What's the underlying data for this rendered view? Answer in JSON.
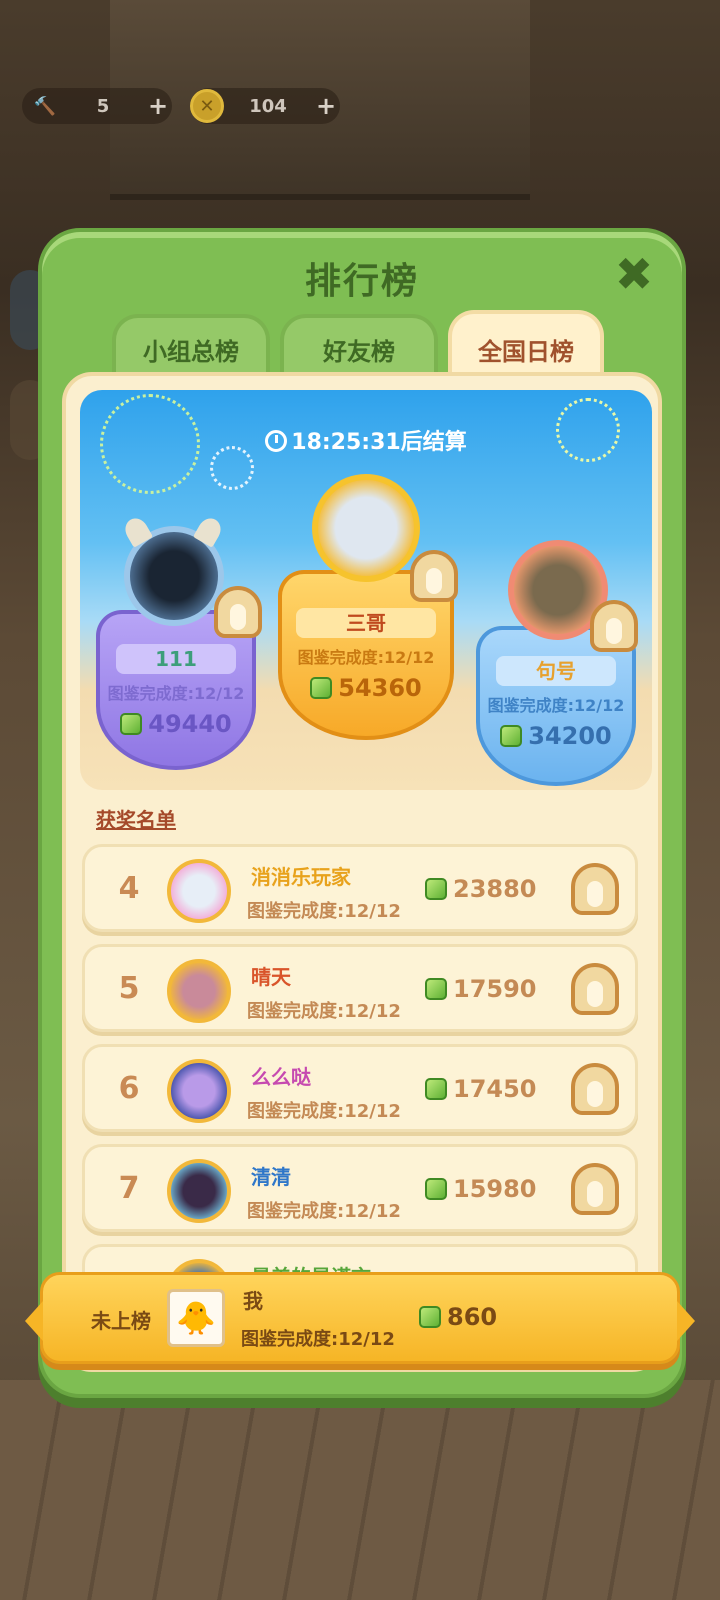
{
  "resources": {
    "hammer": {
      "value": "5",
      "plus": "+"
    },
    "coin": {
      "value": "104",
      "plus": "+"
    }
  },
  "panel": {
    "title": "排行榜",
    "close_icon": "✖"
  },
  "tabs": [
    {
      "label": "小组总榜",
      "active": false
    },
    {
      "label": "好友榜",
      "active": false
    },
    {
      "label": "全国日榜",
      "active": true
    }
  ],
  "timer": {
    "text": "18:25:31后结算"
  },
  "podium": [
    {
      "place": 2,
      "name": "111",
      "completion": "图鉴完成度:12/12",
      "score": "49440"
    },
    {
      "place": 1,
      "name": "三哥",
      "completion": "图鉴完成度:12/12",
      "score": "54360"
    },
    {
      "place": 3,
      "name": "句号",
      "completion": "图鉴完成度:12/12",
      "score": "34200"
    }
  ],
  "winners_label": "获奖名单",
  "rows": [
    {
      "rank": "4",
      "name": "消消乐玩家",
      "completion": "图鉴完成度:12/12",
      "score": "23880",
      "name_color": "#e8a21c"
    },
    {
      "rank": "5",
      "name": "晴天",
      "completion": "图鉴完成度:12/12",
      "score": "17590",
      "name_color": "#d9542a"
    },
    {
      "rank": "6",
      "name": "么么哒",
      "completion": "图鉴完成度:12/12",
      "score": "17450",
      "name_color": "#c64ab0"
    },
    {
      "rank": "7",
      "name": "清清",
      "completion": "图鉴完成度:12/12",
      "score": "15980",
      "name_color": "#2f77c9"
    },
    {
      "rank": "",
      "name": "最美的是谎言",
      "completion": "",
      "score": "",
      "name_color": "#57a63a"
    }
  ],
  "me": {
    "rank_text": "未上榜",
    "name": "我",
    "completion": "图鉴完成度:12/12",
    "score": "860"
  },
  "colors": {
    "panel_green": "#7fbe53",
    "active_tab": "#fff1cc",
    "gold": "#f6b526"
  }
}
